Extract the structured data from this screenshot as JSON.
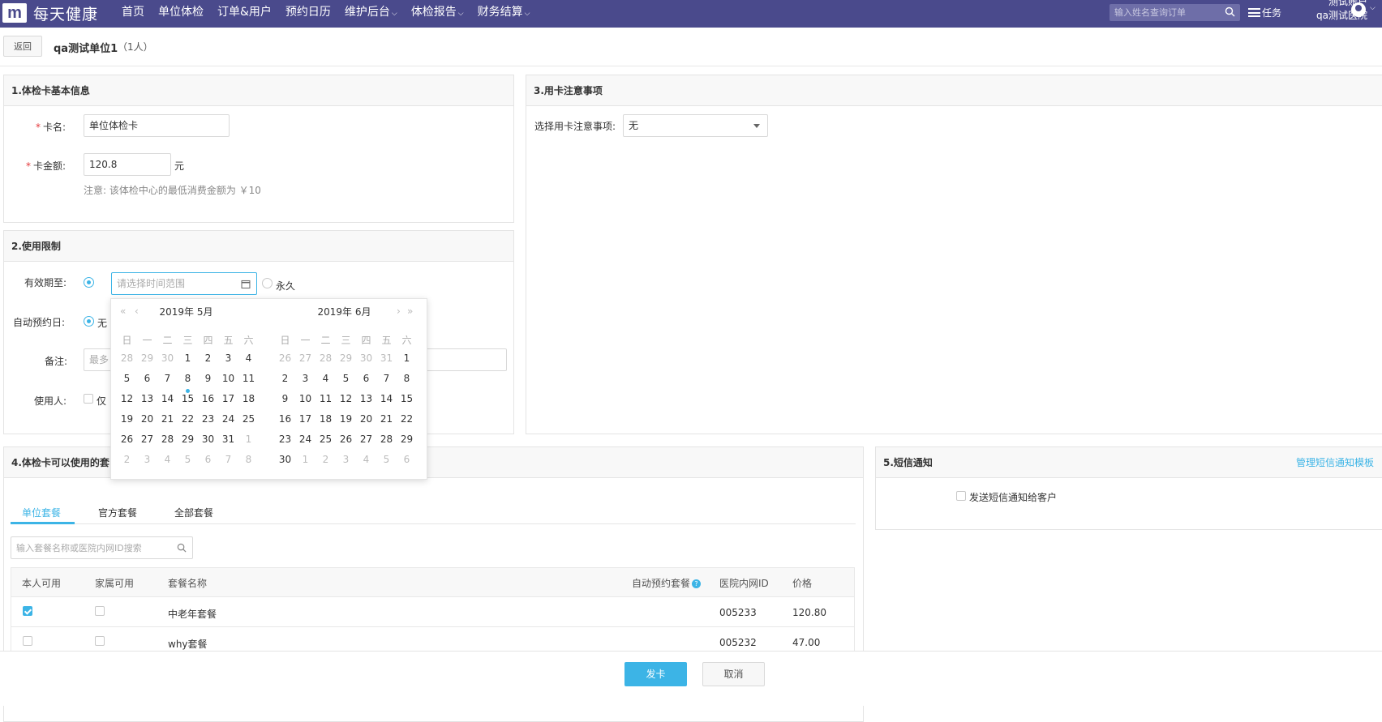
{
  "brand": {
    "logo_mark": "m",
    "name": "每天健康"
  },
  "nav": [
    {
      "label": "首页",
      "dropdown": false
    },
    {
      "label": "单位体检",
      "dropdown": false
    },
    {
      "label": "订单&用户",
      "dropdown": false
    },
    {
      "label": "预约日历",
      "dropdown": false
    },
    {
      "label": "维护后台",
      "dropdown": true
    },
    {
      "label": "体检报告",
      "dropdown": true
    },
    {
      "label": "财务结算",
      "dropdown": true
    }
  ],
  "header": {
    "search_placeholder": "输入姓名查询订单",
    "tasks_label": "任务",
    "account_line1": "测试账户",
    "account_line2": "qa测试医院"
  },
  "subheader": {
    "back_label": "返回",
    "unit_name": "qa测试单位1",
    "unit_count": "（1人）"
  },
  "section1": {
    "title": "1.体检卡基本信息",
    "card_name_label": "卡名:",
    "card_name_value": "单位体检卡",
    "amount_label": "卡金额:",
    "amount_value": "120.8",
    "amount_unit": "元",
    "note": "注意: 该体检中心的最低消费金额为 ￥10"
  },
  "section2": {
    "title": "2.使用限制",
    "valid_label": "有效期至:",
    "date_placeholder": "请选择时间范围",
    "forever_label": "永久",
    "auto_label": "自动预约日:",
    "auto_option": "无",
    "remark_label": "备注:",
    "remark_placeholder": "最多",
    "user_label": "使用人:",
    "user_option": "仅"
  },
  "section3": {
    "title": "3.用卡注意事项",
    "select_label": "选择用卡注意事项:",
    "select_value": "无"
  },
  "section4": {
    "title": "4.体检卡可以使用的套",
    "tabs": [
      "单位套餐",
      "官方套餐",
      "全部套餐"
    ],
    "search_placeholder": "输入套餐名称或医院内网ID搜索",
    "columns": [
      "本人可用",
      "家属可用",
      "套餐名称",
      "自动预约套餐",
      "医院内网ID",
      "价格"
    ],
    "rows": [
      {
        "self": true,
        "family": false,
        "name": "中老年套餐",
        "id": "005233",
        "price": "120.80"
      },
      {
        "self": false,
        "family": false,
        "name": "why套餐",
        "id": "005232",
        "price": "47.00"
      }
    ]
  },
  "section5": {
    "title": "5.短信通知",
    "manage_link": "管理短信通知模板",
    "send_label": "发送短信通知给客户"
  },
  "calendar": {
    "left_title": "2019年 5月",
    "right_title": "2019年 6月",
    "weekdays": [
      "日",
      "一",
      "二",
      "三",
      "四",
      "五",
      "六"
    ],
    "left_days": [
      "28",
      "29",
      "30",
      "1",
      "2",
      "3",
      "4",
      "5",
      "6",
      "7",
      "8",
      "9",
      "10",
      "11",
      "12",
      "13",
      "14",
      "15",
      "16",
      "17",
      "18",
      "19",
      "20",
      "21",
      "22",
      "23",
      "24",
      "25",
      "26",
      "27",
      "28",
      "29",
      "30",
      "31",
      "1",
      "2",
      "3",
      "4",
      "5",
      "6",
      "7",
      "8"
    ],
    "right_days": [
      "26",
      "27",
      "28",
      "29",
      "30",
      "31",
      "1",
      "2",
      "3",
      "4",
      "5",
      "6",
      "7",
      "8",
      "9",
      "10",
      "11",
      "12",
      "13",
      "14",
      "15",
      "16",
      "17",
      "18",
      "19",
      "20",
      "21",
      "22",
      "23",
      "24",
      "25",
      "26",
      "27",
      "28",
      "29",
      "30",
      "1",
      "2",
      "3",
      "4",
      "5",
      "6"
    ],
    "left_current_start": 3,
    "left_current_end": 33,
    "right_current_start": 6,
    "right_current_end": 35,
    "today_index": 17
  },
  "footer": {
    "submit_label": "发卡",
    "cancel_label": "取消"
  }
}
